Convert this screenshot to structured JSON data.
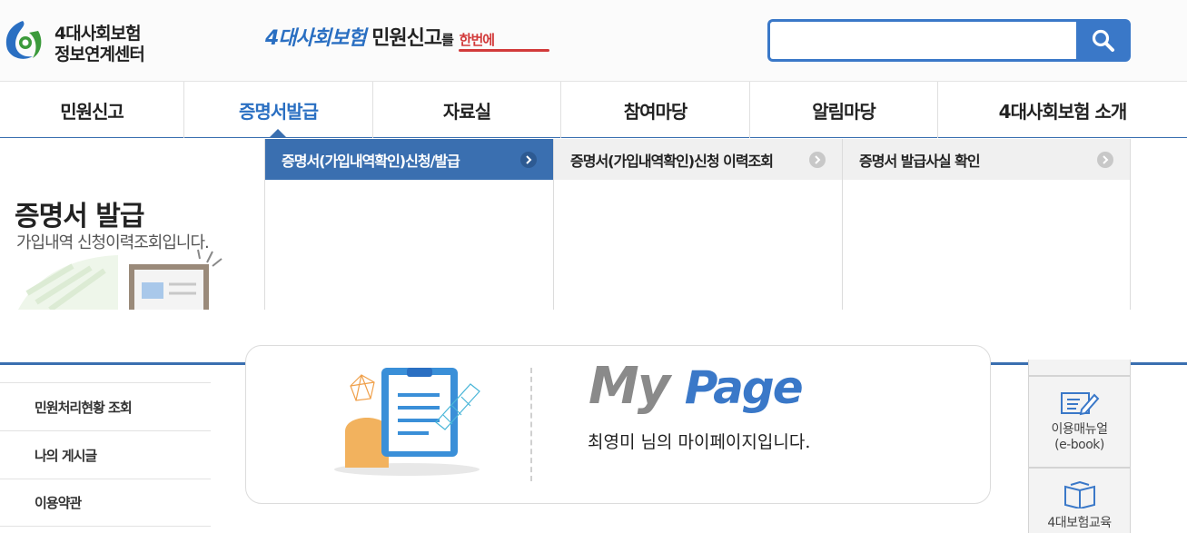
{
  "header": {
    "logo_line1": "4대사회보험",
    "logo_line2": "정보연계센터",
    "slogan_part1": "4대사회보험",
    "slogan_part2": "민원신고",
    "slogan_part3": "를",
    "slogan_part4": "한번에",
    "search_placeholder": ""
  },
  "gnb": {
    "items": [
      {
        "label": "민원신고",
        "active": false
      },
      {
        "label": "증명서발급",
        "active": true
      },
      {
        "label": "자료실",
        "active": false
      },
      {
        "label": "참여마당",
        "active": false
      },
      {
        "label": "알림마당",
        "active": false
      },
      {
        "label": "4대사회보험 소개",
        "active": false
      }
    ]
  },
  "dropdown": {
    "title": "증명서 발급",
    "description": "가입내역 신청이력조회입니다.",
    "columns": [
      {
        "label": "증명서(가입내역확인)신청/발급",
        "active": true
      },
      {
        "label": "증명서(가입내역확인)신청 이력조회",
        "active": false
      },
      {
        "label": "증명서 발급사실 확인",
        "active": false
      }
    ]
  },
  "sidebar": {
    "items": [
      {
        "label": "민원처리현황 조회"
      },
      {
        "label": "나의 게시글"
      },
      {
        "label": "이용약관"
      }
    ]
  },
  "mypage": {
    "logo_my": "My",
    "logo_page": "Page",
    "message": "최영미 님의 마이페이지입니다."
  },
  "quick_menu": {
    "items": [
      {
        "label_line1": "이용매뉴얼",
        "label_line2": "(e-book)"
      },
      {
        "label_line1": "4대보험교육",
        "label_line2": ""
      }
    ]
  },
  "colors": {
    "brand_blue": "#3a6fb0",
    "accent_blue": "#2a6fc2",
    "accent_red": "#d23a3a"
  }
}
